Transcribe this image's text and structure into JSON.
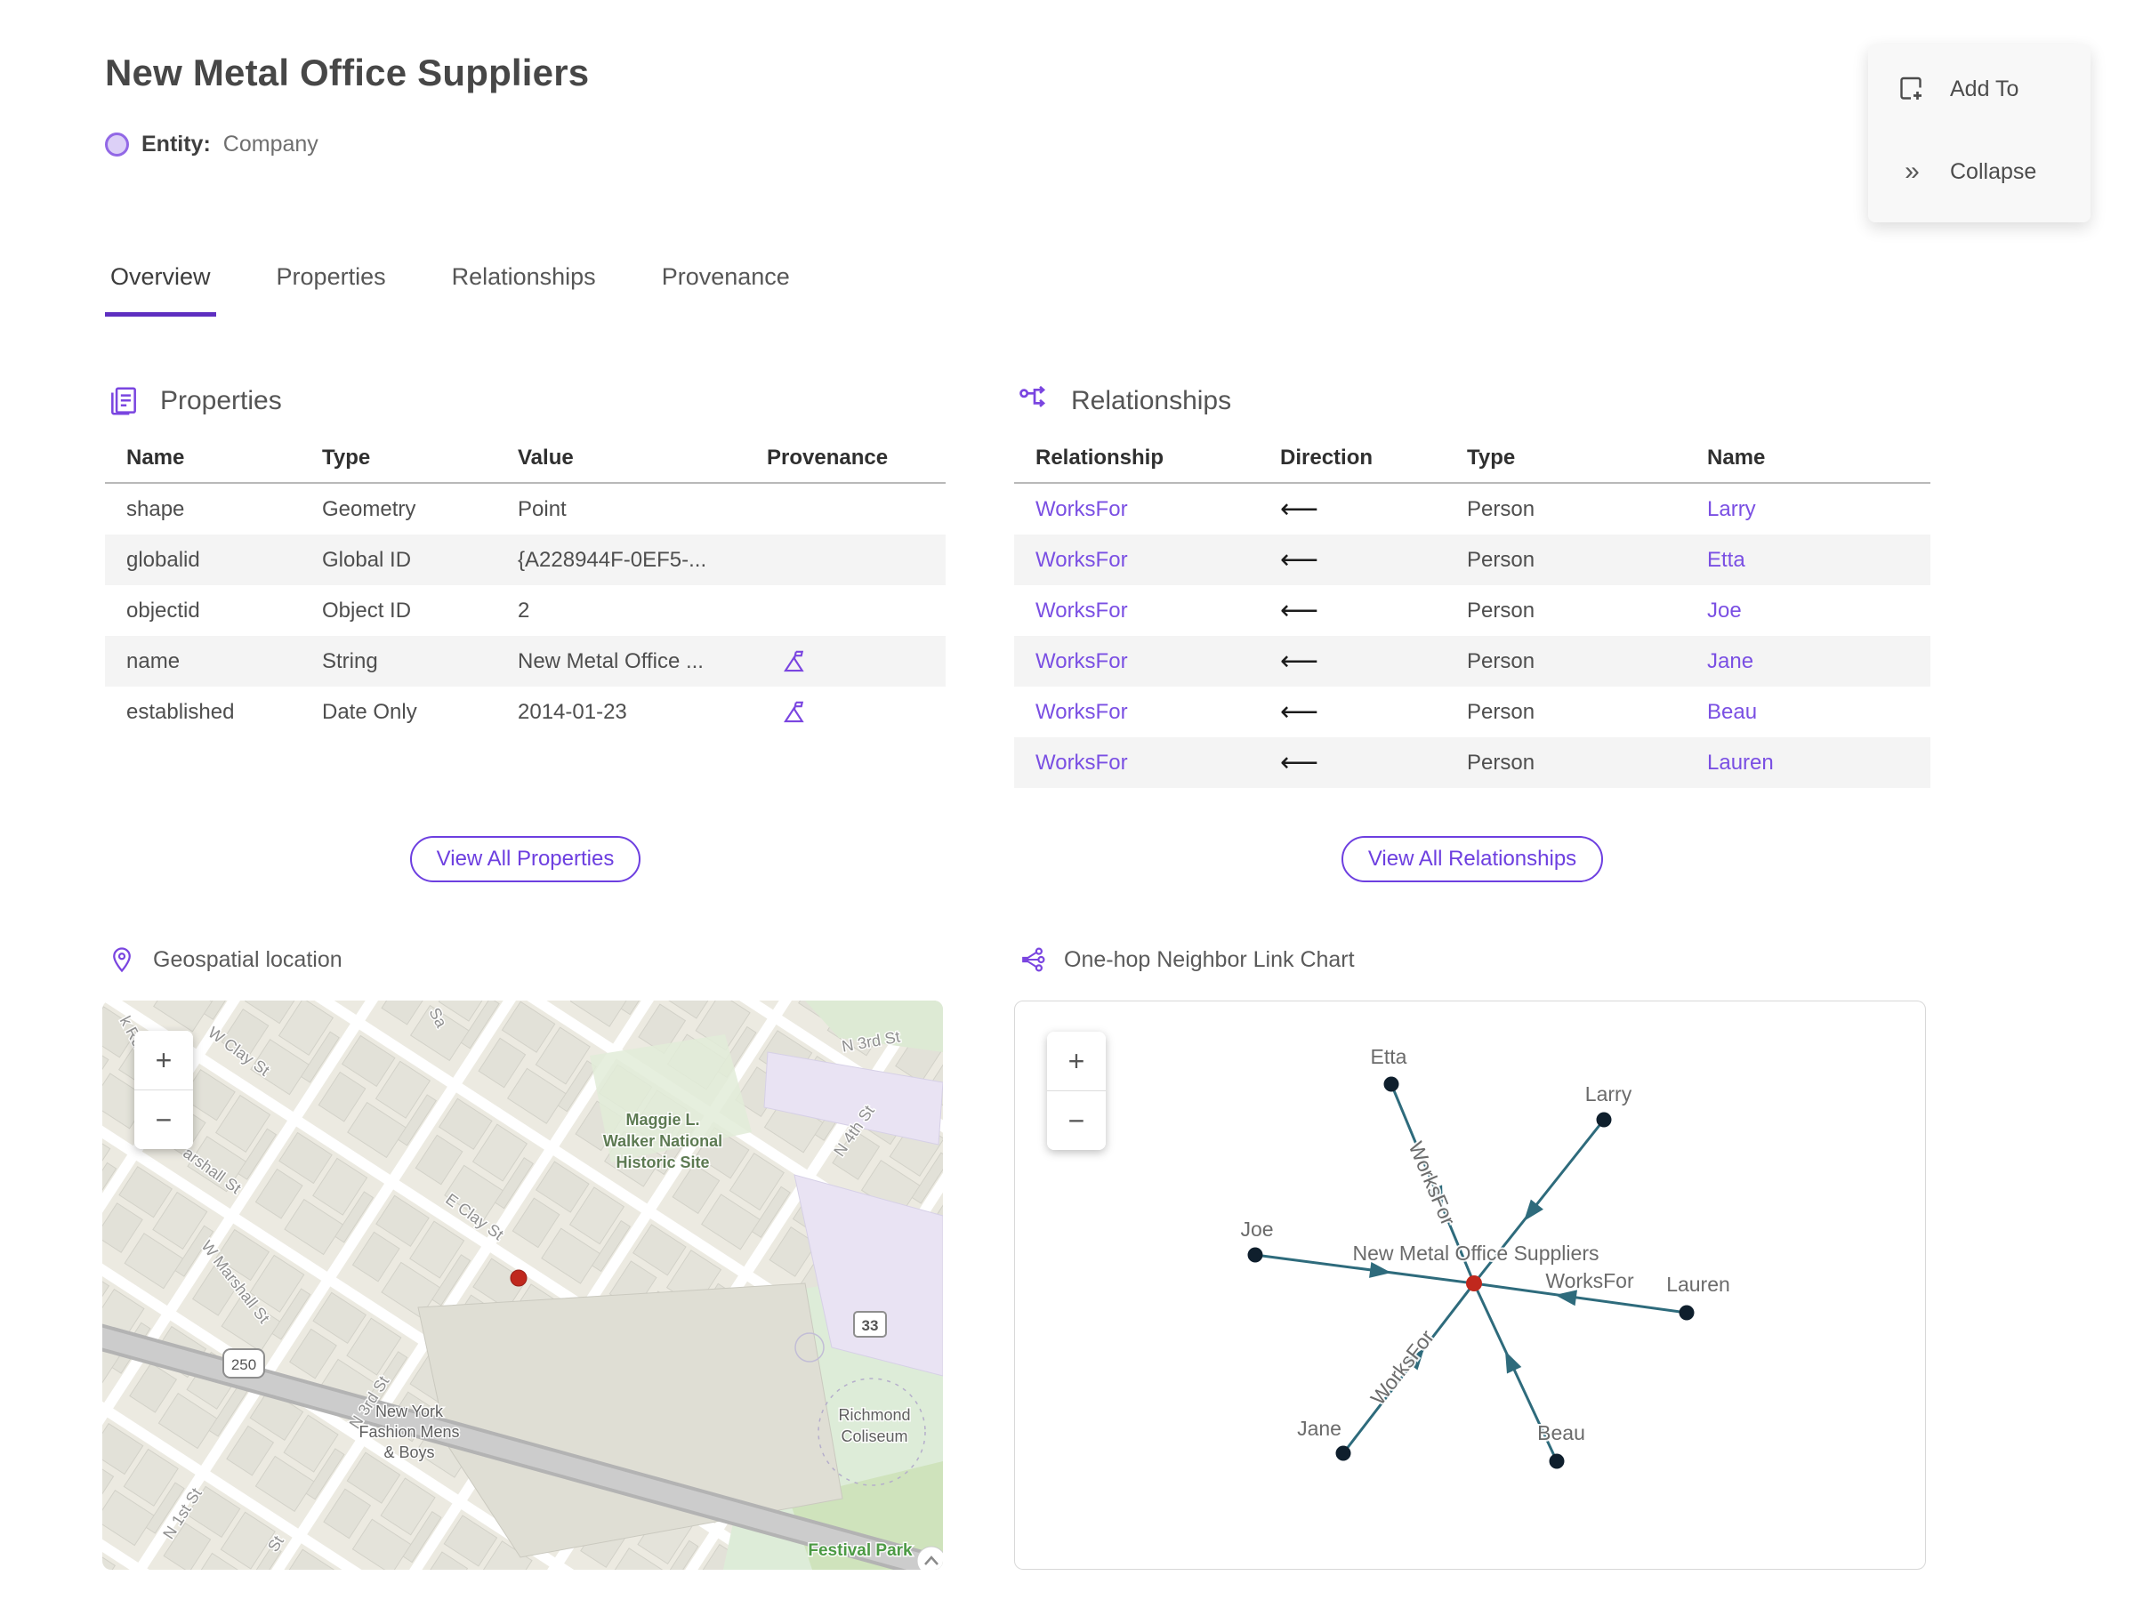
{
  "page": {
    "title": "New Metal Office Suppliers",
    "entity_label": "Entity:",
    "entity_type": "Company"
  },
  "actions": {
    "add_to": "Add To",
    "collapse": "Collapse"
  },
  "tabs": {
    "overview": "Overview",
    "properties": "Properties",
    "relationships": "Relationships",
    "provenance": "Provenance"
  },
  "properties_section": {
    "title": "Properties",
    "columns": {
      "name": "Name",
      "type": "Type",
      "value": "Value",
      "provenance": "Provenance"
    },
    "rows": [
      {
        "name": "shape",
        "type": "Geometry",
        "value": "Point"
      },
      {
        "name": "globalid",
        "type": "Global ID",
        "value": "{A228944F-0EF5-..."
      },
      {
        "name": "objectid",
        "type": "Object ID",
        "value": "2"
      },
      {
        "name": "name",
        "type": "String",
        "value": "New Metal Office ..."
      },
      {
        "name": "established",
        "type": "Date Only",
        "value": "2014-01-23"
      }
    ],
    "view_all_label": "View All Properties"
  },
  "relationships_section": {
    "title": "Relationships",
    "columns": {
      "relationship": "Relationship",
      "direction": "Direction",
      "type": "Type",
      "name": "Name"
    },
    "rows": [
      {
        "relationship": "WorksFor",
        "direction": "⟵",
        "type": "Person",
        "name": "Larry"
      },
      {
        "relationship": "WorksFor",
        "direction": "⟵",
        "type": "Person",
        "name": "Etta"
      },
      {
        "relationship": "WorksFor",
        "direction": "⟵",
        "type": "Person",
        "name": "Joe"
      },
      {
        "relationship": "WorksFor",
        "direction": "⟵",
        "type": "Person",
        "name": "Jane"
      },
      {
        "relationship": "WorksFor",
        "direction": "⟵",
        "type": "Person",
        "name": "Beau"
      },
      {
        "relationship": "WorksFor",
        "direction": "⟵",
        "type": "Person",
        "name": "Lauren"
      }
    ],
    "view_all_label": "View All Relationships"
  },
  "geo_section": {
    "title": "Geospatial location",
    "zoom_in": "+",
    "zoom_out": "−",
    "labels": {
      "k_rd": "k Rd",
      "w_clay": "W Clay St",
      "sa": "Sa",
      "marshall": "arshall St",
      "w_marshall": "W Marshall St",
      "e_clay": "E Clay St",
      "n3rd_mid": "N 3rd St",
      "n3rd_top": "N 3rd St",
      "n4th": "N 4th St",
      "n1st": "N 1st St",
      "st_part": "St",
      "maggie_1": "Maggie L.",
      "maggie_2": "Walker National",
      "maggie_3": "Historic Site",
      "ny_1": "New York",
      "ny_2": "Fashion Mens",
      "ny_3": "& Boys",
      "richmond_1": "Richmond",
      "richmond_2": "Coliseum",
      "festival": "Festival Park",
      "shield_250": "250",
      "shield_33": "33"
    }
  },
  "linkchart_section": {
    "title": "One-hop Neighbor Link Chart",
    "zoom_in": "+",
    "zoom_out": "−",
    "center_label": "New Metal Office Suppliers",
    "edge_label": "WorksFor",
    "nodes": {
      "etta": "Etta",
      "larry": "Larry",
      "joe": "Joe",
      "lauren": "Lauren",
      "jane": "Jane",
      "beau": "Beau"
    }
  },
  "colors": {
    "accent_purple": "#7a45e0",
    "link_purple": "#7a4fe3",
    "tab_underline": "#5e2fc0",
    "edge_teal": "#2e6b7c",
    "node_dark": "#0f1f2d",
    "node_red": "#c0281d",
    "row_stripe": "#f4f4f4"
  }
}
